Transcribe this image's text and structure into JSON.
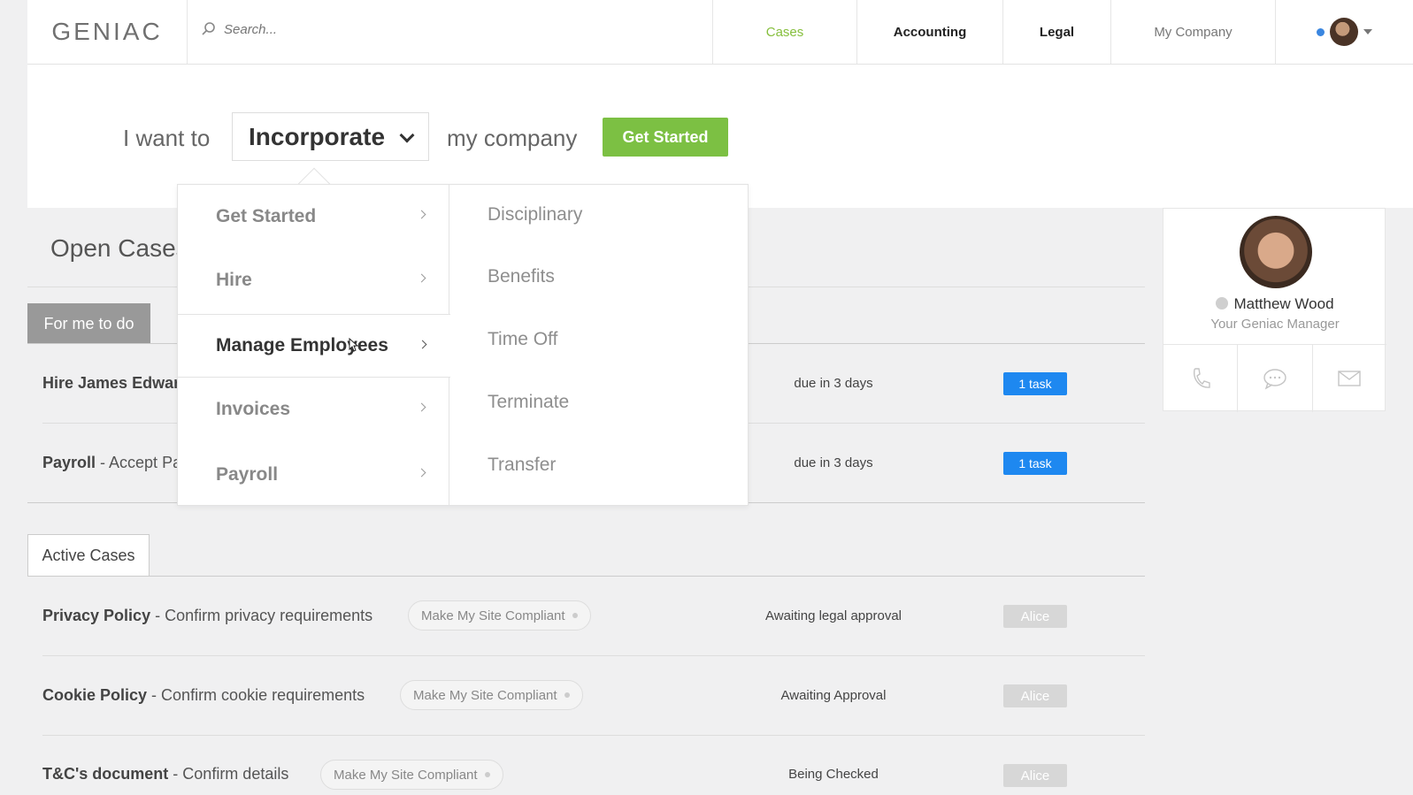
{
  "header": {
    "logo": "GENIAC",
    "search_placeholder": "Search...",
    "nav": {
      "cases": "Cases",
      "accounting": "Accounting",
      "legal": "Legal",
      "my_company": "My Company"
    }
  },
  "intent": {
    "prefix": "I want to",
    "selected_action": "Incorporate",
    "suffix": "my company",
    "button": "Get Started"
  },
  "menu": {
    "categories": [
      {
        "label": "Get Started"
      },
      {
        "label": "Hire"
      },
      {
        "label": "Manage Employees"
      },
      {
        "label": "Invoices"
      },
      {
        "label": "Payroll"
      }
    ],
    "active_category": "Manage Employees",
    "subitems": [
      {
        "label": "Disciplinary"
      },
      {
        "label": "Benefits"
      },
      {
        "label": "Time Off"
      },
      {
        "label": "Terminate"
      },
      {
        "label": "Transfer"
      }
    ]
  },
  "open_cases": {
    "title": "Open Cases",
    "tab_todo": "For me to do",
    "rows": [
      {
        "title": "Hire James Edwar",
        "desc": "",
        "due": "due in 3 days",
        "badge": "1 task"
      },
      {
        "title": "Payroll",
        "desc": " - Accept Pa",
        "due": "due in 3 days",
        "badge": "1 task"
      }
    ]
  },
  "active_cases": {
    "tab": "Active Cases",
    "rows": [
      {
        "title": "Privacy Policy",
        "desc": " - Confirm privacy requirements",
        "tag": "Make My Site Compliant",
        "status": "Awaiting legal approval",
        "assignee": "Alice"
      },
      {
        "title": "Cookie Policy",
        "desc": " - Confirm cookie requirements",
        "tag": "Make My Site Compliant",
        "status": "Awaiting Approval",
        "assignee": "Alice"
      },
      {
        "title": "T&C's document",
        "desc": " - Confirm details",
        "tag": "Make My Site Compliant",
        "status": "Being Checked",
        "assignee": "Alice"
      }
    ]
  },
  "manager": {
    "name": "Matthew Wood",
    "role": "Your Geniac Manager",
    "actions": [
      "phone-icon",
      "chat-icon",
      "mail-icon"
    ]
  },
  "colors": {
    "brand_green": "#7cc043",
    "nav_active": "#86bf3d",
    "badge_blue": "#1e88f0",
    "status_dot": "#3a86e0"
  }
}
